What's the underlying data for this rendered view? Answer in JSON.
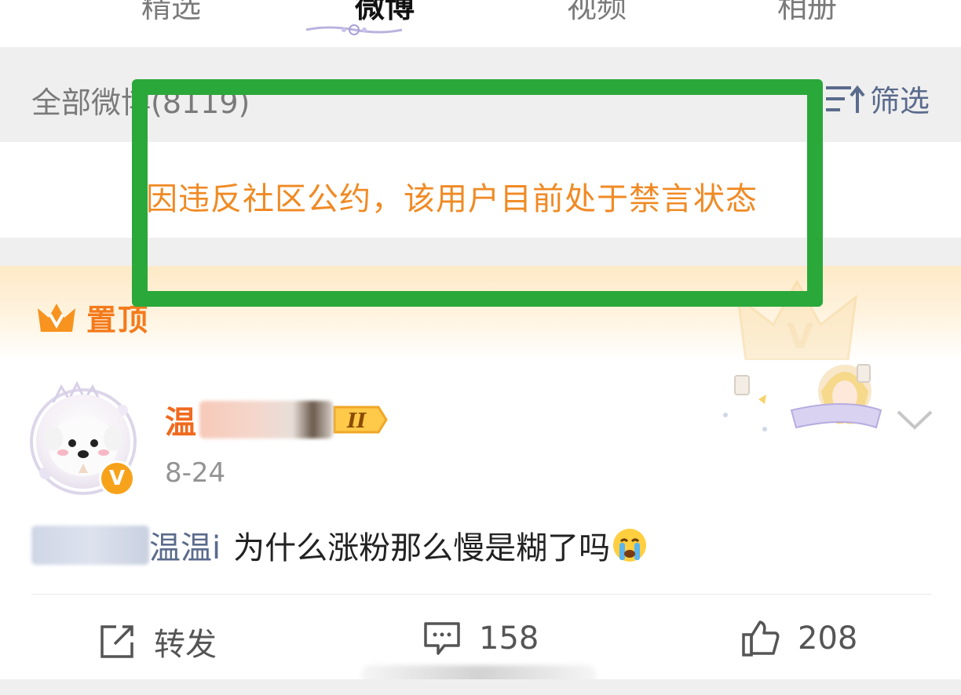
{
  "tabs": [
    {
      "label": "精选"
    },
    {
      "label": "微博"
    },
    {
      "label": "视频"
    },
    {
      "label": "相册"
    }
  ],
  "filter_bar": {
    "all_weibo": "全部微博(8119)",
    "filter_label": "筛选"
  },
  "notice": {
    "text": "因违反社区公约，该用户目前处于禁言状态"
  },
  "pinned": {
    "label": "置顶"
  },
  "post": {
    "username_visible": "温",
    "level_badge": "II",
    "date": "8-24",
    "mention_suffix": "温温i",
    "content": "为什么涨粉那么慢是糊了吗",
    "actions": {
      "repost_label": "转发",
      "comment_count": "158",
      "like_count": "208"
    }
  },
  "colors": {
    "accent_orange": "#f08a24",
    "username_orange": "#f06a1e",
    "link_blue": "#5a6b8c",
    "annotation_green": "#2aa83a",
    "bar_grey": "#efefef"
  }
}
